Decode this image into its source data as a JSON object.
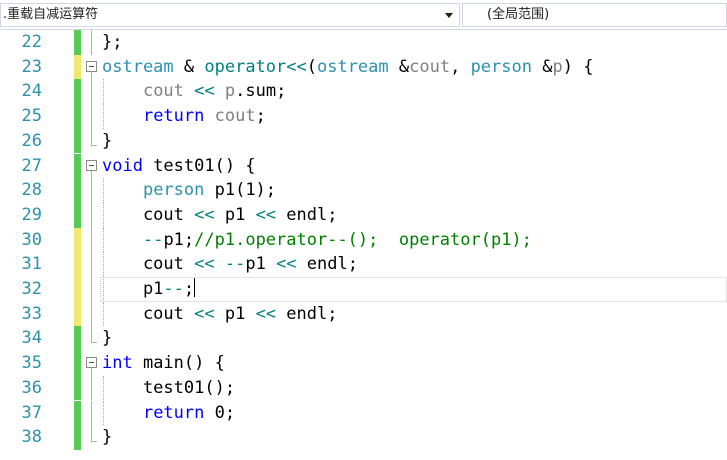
{
  "nav": {
    "scope_combo": ".重载自减运算符",
    "member_combo": "(全局范围)"
  },
  "lines": [
    {
      "num": "22",
      "change": "saved",
      "tokens": [
        {
          "t": "};",
          "c": ""
        }
      ]
    },
    {
      "num": "23",
      "change": "unsaved",
      "fold": "start",
      "tokens": [
        {
          "t": "ostream",
          "c": "ty"
        },
        {
          "t": " & ",
          "c": ""
        },
        {
          "t": "operator<<",
          "c": "op"
        },
        {
          "t": "(",
          "c": ""
        },
        {
          "t": "ostream",
          "c": "ty"
        },
        {
          "t": " &",
          "c": ""
        },
        {
          "t": "cout",
          "c": "param"
        },
        {
          "t": ", ",
          "c": ""
        },
        {
          "t": "person",
          "c": "ty"
        },
        {
          "t": " &",
          "c": ""
        },
        {
          "t": "p",
          "c": "param"
        },
        {
          "t": ") {",
          "c": ""
        }
      ]
    },
    {
      "num": "24",
      "change": "saved",
      "tokens": [
        {
          "t": "    ",
          "c": ""
        },
        {
          "t": "cout",
          "c": "param"
        },
        {
          "t": " ",
          "c": ""
        },
        {
          "t": "<<",
          "c": "op"
        },
        {
          "t": " ",
          "c": ""
        },
        {
          "t": "p",
          "c": "param"
        },
        {
          "t": ".sum;",
          "c": ""
        }
      ]
    },
    {
      "num": "25",
      "change": "saved",
      "tokens": [
        {
          "t": "    ",
          "c": ""
        },
        {
          "t": "return",
          "c": "kw"
        },
        {
          "t": " ",
          "c": ""
        },
        {
          "t": "cout",
          "c": "param"
        },
        {
          "t": ";",
          "c": ""
        }
      ]
    },
    {
      "num": "26",
      "change": "saved",
      "fold": "end",
      "tokens": [
        {
          "t": "}",
          "c": ""
        }
      ]
    },
    {
      "num": "27",
      "change": "saved",
      "fold": "start",
      "tokens": [
        {
          "t": "void",
          "c": "kw"
        },
        {
          "t": " test01() {",
          "c": ""
        }
      ]
    },
    {
      "num": "28",
      "change": "saved",
      "tokens": [
        {
          "t": "    ",
          "c": ""
        },
        {
          "t": "person",
          "c": "ty"
        },
        {
          "t": " p1(1);",
          "c": ""
        }
      ]
    },
    {
      "num": "29",
      "change": "saved",
      "tokens": [
        {
          "t": "    cout ",
          "c": ""
        },
        {
          "t": "<<",
          "c": "op"
        },
        {
          "t": " p1 ",
          "c": ""
        },
        {
          "t": "<<",
          "c": "op"
        },
        {
          "t": " endl;",
          "c": ""
        }
      ]
    },
    {
      "num": "30",
      "change": "unsaved",
      "tokens": [
        {
          "t": "    ",
          "c": ""
        },
        {
          "t": "--",
          "c": "op"
        },
        {
          "t": "p1;",
          "c": ""
        },
        {
          "t": "//p1.operator--();  operator(p1);",
          "c": "cm"
        }
      ]
    },
    {
      "num": "31",
      "change": "unsaved",
      "tokens": [
        {
          "t": "    cout ",
          "c": ""
        },
        {
          "t": "<<",
          "c": "op"
        },
        {
          "t": " ",
          "c": ""
        },
        {
          "t": "--",
          "c": "op"
        },
        {
          "t": "p1 ",
          "c": ""
        },
        {
          "t": "<<",
          "c": "op"
        },
        {
          "t": " endl;",
          "c": ""
        }
      ]
    },
    {
      "num": "32",
      "change": "unsaved",
      "current": true,
      "tokens": [
        {
          "t": "    p1",
          "c": ""
        },
        {
          "t": "--",
          "c": "op"
        },
        {
          "t": ";",
          "c": ""
        }
      ]
    },
    {
      "num": "33",
      "change": "unsaved",
      "tokens": [
        {
          "t": "    cout ",
          "c": ""
        },
        {
          "t": "<<",
          "c": "op"
        },
        {
          "t": " p1 ",
          "c": ""
        },
        {
          "t": "<<",
          "c": "op"
        },
        {
          "t": " endl;",
          "c": ""
        }
      ]
    },
    {
      "num": "34",
      "change": "saved",
      "fold": "end",
      "tokens": [
        {
          "t": "}",
          "c": ""
        }
      ]
    },
    {
      "num": "35",
      "change": "saved",
      "fold": "start",
      "tokens": [
        {
          "t": "int",
          "c": "kw"
        },
        {
          "t": " main() {",
          "c": ""
        }
      ]
    },
    {
      "num": "36",
      "change": "saved",
      "tokens": [
        {
          "t": "    test01();",
          "c": ""
        }
      ]
    },
    {
      "num": "37",
      "change": "saved",
      "tokens": [
        {
          "t": "    ",
          "c": ""
        },
        {
          "t": "return",
          "c": "kw"
        },
        {
          "t": " 0;",
          "c": ""
        }
      ]
    },
    {
      "num": "38",
      "change": "saved",
      "fold": "end",
      "tokens": [
        {
          "t": "}",
          "c": ""
        }
      ]
    }
  ]
}
